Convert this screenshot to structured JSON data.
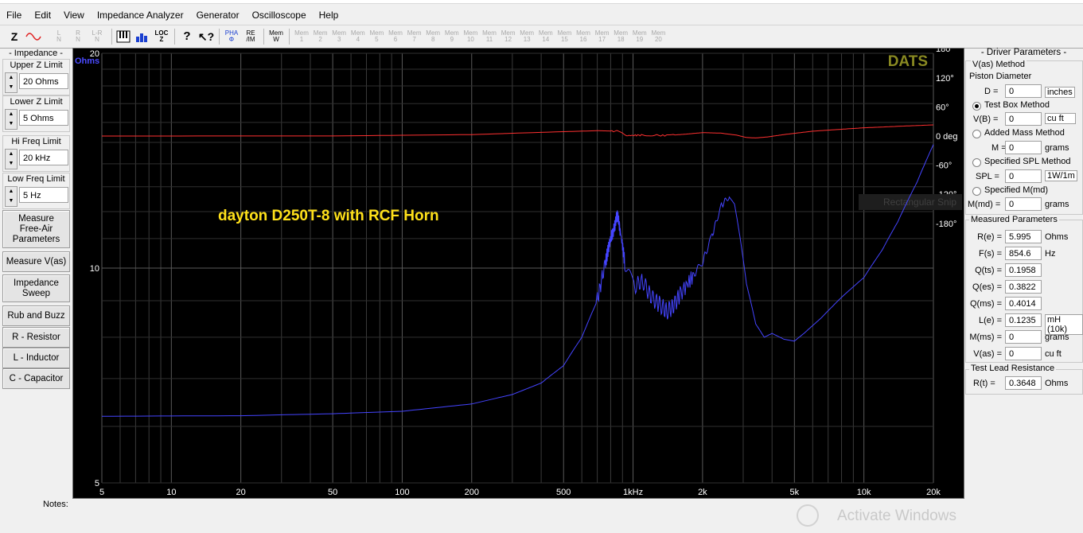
{
  "menu": [
    "File",
    "Edit",
    "View",
    "Impedance Analyzer",
    "Generator",
    "Oscilloscope",
    "Help"
  ],
  "toolbar": {
    "z_label": "Z",
    "graph_labels": [
      "L\nN",
      "R\nN",
      "L-R\nN"
    ],
    "loc_label": "LOC\nZ",
    "pha_label": "PHA\nΦ",
    "reim_label": "RE\n/IM",
    "mem_label": "Mem\nW",
    "mem_slots": [
      "1",
      "2",
      "3",
      "4",
      "5",
      "6",
      "7",
      "8",
      "9",
      "10",
      "11",
      "12",
      "13",
      "14",
      "15",
      "16",
      "17",
      "18",
      "19",
      "20"
    ],
    "mem_prefix": "Mem"
  },
  "left_panel": {
    "title": "- Impedance -",
    "upper_z": {
      "label": "Upper Z Limit",
      "value": "20 Ohms"
    },
    "lower_z": {
      "label": "Lower Z Limit",
      "value": "5 Ohms"
    },
    "hi_freq": {
      "label": "Hi Freq Limit",
      "value": "20 kHz"
    },
    "low_freq": {
      "label": "Low Freq Limit",
      "value": "5 Hz"
    },
    "buttons": [
      "Measure\nFree-Air\nParameters",
      "Measure V(as)",
      "Impedance\nSweep",
      "Rub and Buzz",
      "R - Resistor",
      "L - Inductor",
      "C - Capacitor"
    ]
  },
  "plot": {
    "brand": "DATS",
    "annotation": "dayton D250T-8 with RCF Horn",
    "ghost_text": "Rectangular Snip",
    "y_unit": "Ohms"
  },
  "chart_data": {
    "type": "line",
    "xscale": "log",
    "xlim": [
      5,
      20000
    ],
    "x_ticks": [
      "5",
      "10",
      "20",
      "50",
      "100",
      "200",
      "500",
      "1kHz",
      "2k",
      "5k",
      "10k",
      "20k"
    ],
    "x_tick_values": [
      5,
      10,
      20,
      50,
      100,
      200,
      500,
      1000,
      2000,
      5000,
      10000,
      20000
    ],
    "y_left": {
      "scale": "log",
      "lim": [
        5,
        20
      ],
      "ticks": [
        "20",
        "10",
        "5"
      ],
      "tick_values": [
        20,
        10,
        5
      ],
      "unit": "Ohms"
    },
    "y_right": {
      "lim": [
        -180,
        180
      ],
      "ticks": [
        "180°",
        "120°",
        "60°",
        "0 deg",
        "-60°",
        "-120°",
        "-180°"
      ],
      "tick_values": [
        180,
        120,
        60,
        0,
        -60,
        -120,
        -180
      ]
    },
    "grid": true,
    "series": [
      {
        "color": "#4444ff",
        "axis": "left",
        "x": [
          5,
          20,
          50,
          100,
          200,
          300,
          400,
          500,
          600,
          700,
          760,
          800,
          830,
          854.6,
          880,
          920,
          1000,
          1100,
          1200,
          1300,
          1400,
          1500,
          1600,
          1800,
          2000,
          2200,
          2400,
          2600,
          2750,
          2900,
          3100,
          3400,
          3700,
          4000,
          4500,
          5000,
          5500,
          6500,
          8000,
          10000,
          12000,
          14000,
          17000,
          20000
        ],
        "y": [
          6.2,
          6.21,
          6.25,
          6.3,
          6.45,
          6.65,
          6.9,
          7.3,
          8.0,
          9.0,
          10.2,
          11.0,
          11.4,
          11.9,
          11.3,
          10.2,
          9.4,
          9.6,
          9.1,
          8.9,
          8.7,
          8.85,
          9.2,
          9.7,
          10.2,
          11.1,
          12.2,
          12.6,
          12.3,
          11.1,
          9.5,
          8.35,
          8.0,
          8.1,
          7.95,
          7.9,
          8.1,
          8.5,
          9.1,
          9.7,
          10.6,
          11.6,
          13.2,
          14.9
        ]
      },
      {
        "color": "#ff3030",
        "axis": "right",
        "x": [
          5,
          50,
          200,
          500,
          700,
          850,
          950,
          1100,
          1400,
          1700,
          2000,
          2400,
          2800,
          3100,
          3400,
          3800,
          4500,
          6000,
          8000,
          10000,
          14000,
          20000
        ],
        "y": [
          0,
          0.2,
          3,
          9,
          11,
          10,
          1,
          2,
          1,
          4,
          7,
          6,
          2,
          -3,
          -4,
          -2,
          3,
          10,
          14,
          17,
          20,
          23
        ]
      }
    ]
  },
  "right_panel": {
    "title": "- Driver Parameters -",
    "vas_method": "V(as) Method",
    "piston": "Piston Diameter",
    "d_label": "D =",
    "d_value": "0",
    "d_unit": "inches",
    "test_box": "Test Box Method",
    "vb_label": "V(B) =",
    "vb_value": "0",
    "vb_unit": "cu ft",
    "added_mass": "Added Mass Method",
    "m_label": "M =",
    "m_value": "0",
    "m_unit": "grams",
    "spl_method": "Specified SPL Method",
    "spl_label": "SPL =",
    "spl_value": "0",
    "spl_unit": "1W/1m",
    "mmd_method": "Specified M(md)",
    "mmd_label": "M(md) =",
    "mmd_value": "0",
    "mmd_unit": "grams",
    "measured_title": "Measured Parameters",
    "params": [
      {
        "label": "R(e) =",
        "value": "5.995",
        "unit": "Ohms"
      },
      {
        "label": "F(s) =",
        "value": "854.6",
        "unit": "Hz"
      },
      {
        "label": "Q(ts) =",
        "value": "0.1958",
        "unit": ""
      },
      {
        "label": "Q(es) =",
        "value": "0.3822",
        "unit": ""
      },
      {
        "label": "Q(ms) =",
        "value": "0.4014",
        "unit": ""
      },
      {
        "label": "L(e) =",
        "value": "0.1235",
        "unit": "mH (10k)"
      },
      {
        "label": "M(ms) =",
        "value": "0",
        "unit": "grams"
      },
      {
        "label": "V(as) =",
        "value": "0",
        "unit": "cu ft"
      }
    ],
    "lead_title": "Test Lead Resistance",
    "rt_label": "R(t) =",
    "rt_value": "0.3648",
    "rt_unit": "Ohms"
  },
  "notes_label": "Notes:",
  "watermark": "Activate Windows"
}
